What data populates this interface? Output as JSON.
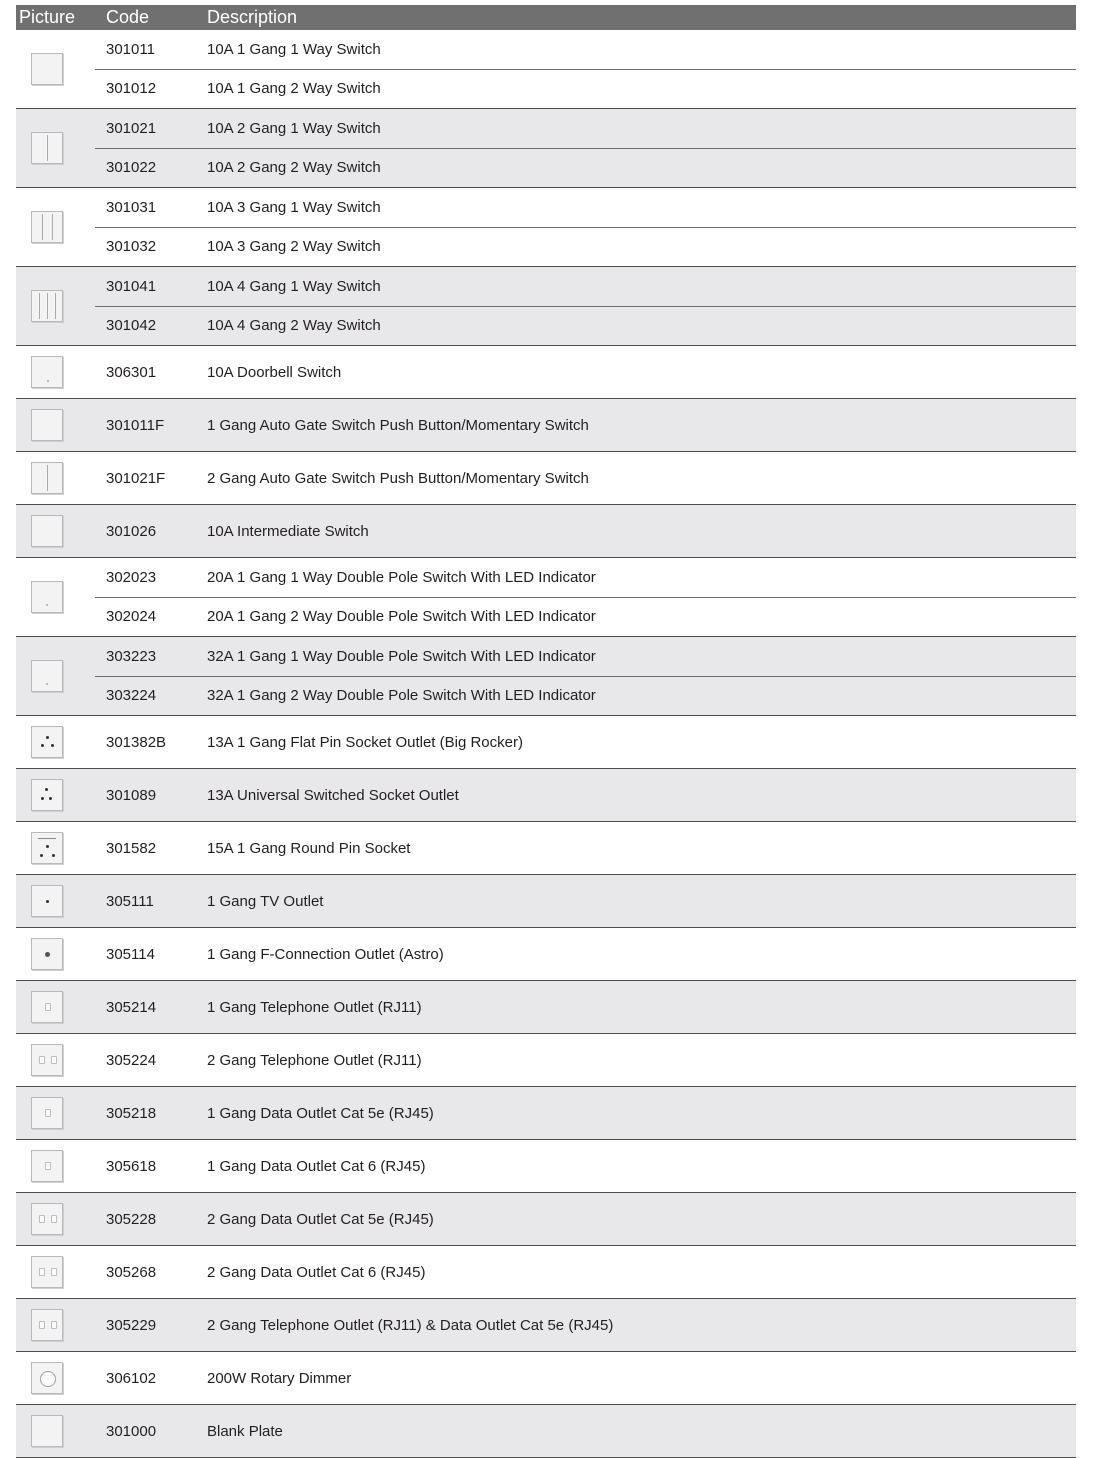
{
  "header": {
    "picture": "Picture",
    "code": "Code",
    "description": "Description"
  },
  "groups": [
    {
      "icon": "switch-1-gang-icon",
      "rows": [
        {
          "code": "301011",
          "description": "10A 1 Gang 1 Way Switch"
        },
        {
          "code": "301012",
          "description": "10A 1 Gang 2 Way Switch"
        }
      ]
    },
    {
      "icon": "switch-2-gang-icon",
      "rows": [
        {
          "code": "301021",
          "description": "10A 2 Gang 1 Way Switch"
        },
        {
          "code": "301022",
          "description": "10A 2 Gang 2 Way Switch"
        }
      ]
    },
    {
      "icon": "switch-3-gang-icon",
      "rows": [
        {
          "code": "301031",
          "description": "10A 3 Gang 1 Way Switch"
        },
        {
          "code": "301032",
          "description": "10A 3 Gang 2 Way Switch"
        }
      ]
    },
    {
      "icon": "switch-4-gang-icon",
      "rows": [
        {
          "code": "301041",
          "description": "10A 4 Gang 1 Way Switch"
        },
        {
          "code": "301042",
          "description": "10A 4 Gang 2 Way Switch"
        }
      ]
    },
    {
      "icon": "doorbell-switch-icon",
      "rows": [
        {
          "code": "306301",
          "description": "10A Doorbell Switch"
        }
      ]
    },
    {
      "icon": "switch-1-gang-icon",
      "rows": [
        {
          "code": "301011F",
          "description": "1 Gang Auto Gate Switch Push Button/Momentary Switch"
        }
      ]
    },
    {
      "icon": "switch-2-gang-icon",
      "rows": [
        {
          "code": "301021F",
          "description": "2 Gang Auto Gate Switch Push Button/Momentary Switch"
        }
      ]
    },
    {
      "icon": "switch-1-gang-icon",
      "rows": [
        {
          "code": "301026",
          "description": "10A Intermediate Switch"
        }
      ]
    },
    {
      "icon": "double-pole-switch-icon",
      "rows": [
        {
          "code": "302023",
          "description": "20A 1 Gang 1 Way Double Pole Switch With LED Indicator"
        },
        {
          "code": "302024",
          "description": "20A 1 Gang 2 Way Double Pole Switch With LED Indicator"
        }
      ]
    },
    {
      "icon": "double-pole-switch-icon",
      "rows": [
        {
          "code": "303223",
          "description": "32A 1 Gang 1 Way Double Pole Switch With LED Indicator"
        },
        {
          "code": "303224",
          "description": "32A 1 Gang 2 Way Double Pole Switch With LED Indicator"
        }
      ]
    },
    {
      "icon": "flat-pin-socket-icon",
      "rows": [
        {
          "code": "301382B",
          "description": "13A 1 Gang Flat Pin Socket Outlet (Big Rocker)"
        }
      ]
    },
    {
      "icon": "universal-socket-icon",
      "rows": [
        {
          "code": "301089",
          "description": "13A Universal Switched Socket Outlet"
        }
      ]
    },
    {
      "icon": "round-pin-socket-icon",
      "rows": [
        {
          "code": "301582",
          "description": "15A 1 Gang Round Pin Socket"
        }
      ]
    },
    {
      "icon": "tv-outlet-icon",
      "rows": [
        {
          "code": "305111",
          "description": "1 Gang TV Outlet"
        }
      ]
    },
    {
      "icon": "f-connection-outlet-icon",
      "rows": [
        {
          "code": "305114",
          "description": "1 Gang F-Connection Outlet (Astro)"
        }
      ]
    },
    {
      "icon": "telephone-outlet-1-gang-icon",
      "rows": [
        {
          "code": "305214",
          "description": "1 Gang Telephone Outlet (RJ11)"
        }
      ]
    },
    {
      "icon": "telephone-outlet-2-gang-icon",
      "rows": [
        {
          "code": "305224",
          "description": "2 Gang Telephone Outlet (RJ11)"
        }
      ]
    },
    {
      "icon": "data-outlet-1-gang-icon",
      "rows": [
        {
          "code": "305218",
          "description": "1 Gang Data Outlet Cat 5e (RJ45)"
        }
      ]
    },
    {
      "icon": "data-outlet-1-gang-icon",
      "rows": [
        {
          "code": "305618",
          "description": "1 Gang Data Outlet Cat 6 (RJ45)"
        }
      ]
    },
    {
      "icon": "data-outlet-2-gang-icon",
      "rows": [
        {
          "code": "305228",
          "description": "2 Gang Data Outlet Cat 5e (RJ45)"
        }
      ]
    },
    {
      "icon": "data-outlet-2-gang-icon",
      "rows": [
        {
          "code": "305268",
          "description": "2 Gang Data Outlet Cat 6 (RJ45)"
        }
      ]
    },
    {
      "icon": "telephone-data-outlet-icon",
      "rows": [
        {
          "code": "305229",
          "description": "2 Gang Telephone Outlet (RJ11) & Data Outlet Cat 5e (RJ45)"
        }
      ]
    },
    {
      "icon": "rotary-dimmer-icon",
      "rows": [
        {
          "code": "306102",
          "description": "200W Rotary Dimmer"
        }
      ]
    },
    {
      "icon": "blank-plate-icon",
      "rows": [
        {
          "code": "301000",
          "description": "Blank Plate"
        }
      ]
    }
  ]
}
